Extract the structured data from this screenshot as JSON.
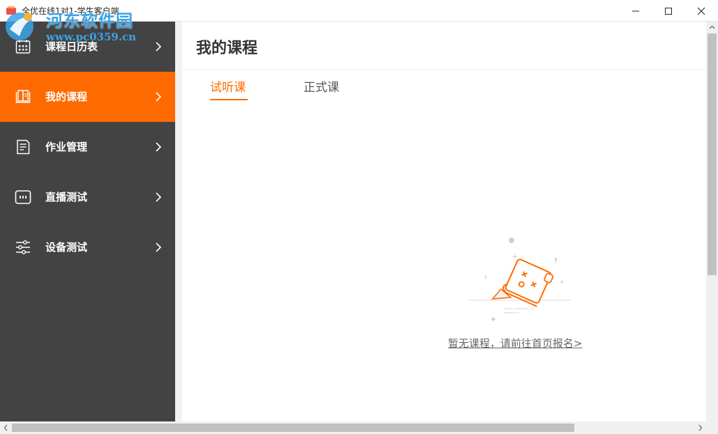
{
  "window": {
    "title": "全优在线1对1-学生客户端",
    "minimize_icon": "minimize-icon",
    "maximize_icon": "maximize-icon",
    "close_icon": "close-icon"
  },
  "watermark": {
    "line1": "河东软件园",
    "line2": "www.pc0359.cn"
  },
  "sidebar": {
    "items": [
      {
        "label": "课程日历表",
        "icon": "calendar-icon",
        "active": false
      },
      {
        "label": "我的课程",
        "icon": "book-icon",
        "active": true
      },
      {
        "label": "作业管理",
        "icon": "document-icon",
        "active": false
      },
      {
        "label": "直播测试",
        "icon": "live-screen-icon",
        "active": false
      },
      {
        "label": "设备测试",
        "icon": "sliders-icon",
        "active": false
      }
    ]
  },
  "main": {
    "title": "我的课程",
    "tabs": [
      {
        "label": "试听课",
        "active": true
      },
      {
        "label": "正式课",
        "active": false
      }
    ],
    "empty_state": {
      "icon": "empty-box-illustration",
      "link_text": "暂无课程，请前往首页报名>"
    }
  },
  "colors": {
    "accent": "#ff6a00",
    "sidebar_bg": "#434343",
    "watermark": "#3aa3e6"
  }
}
